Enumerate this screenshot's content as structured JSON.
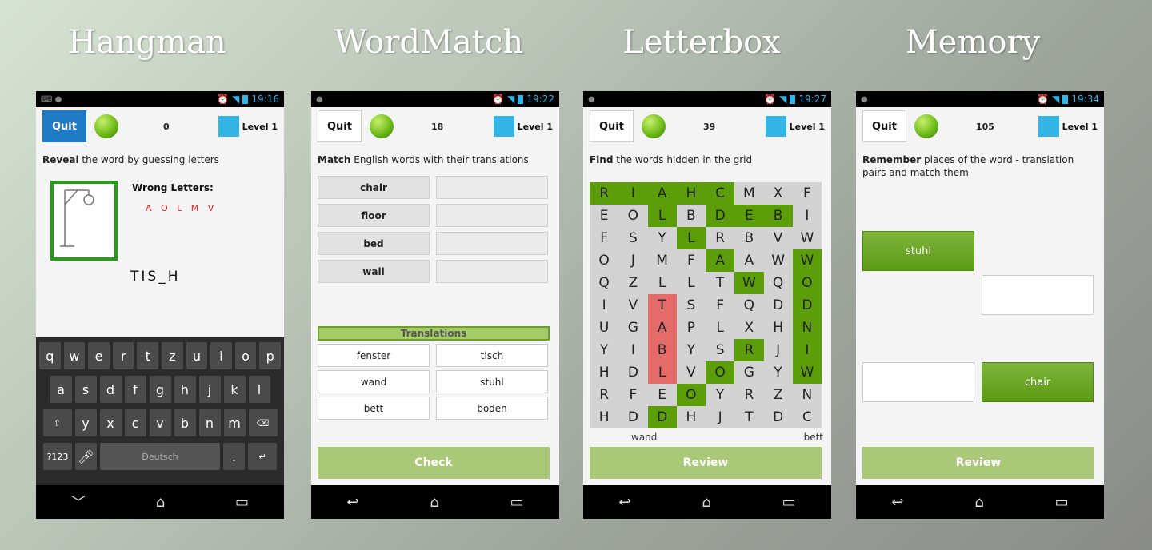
{
  "titles": [
    "Hangman",
    "WordMatch",
    "Letterbox",
    "Memory"
  ],
  "colors": {
    "accent_green": "#5b9e0a",
    "blue": "#33b5e5",
    "quit_blue": "#1e7ac4",
    "wrong_red": "#d22222",
    "button_green": "#a9c978"
  },
  "common": {
    "quit_label": "Quit",
    "level_label": "Level 1"
  },
  "hangman": {
    "time": "19:16",
    "score": "0",
    "instr_bold": "Reveal",
    "instr_rest": " the word by guessing letters",
    "wrong_title": "Wrong Letters:",
    "wrong_letters": "A O L M V",
    "word": "TIS_H",
    "keyboard": {
      "row1": [
        "q",
        "w",
        "e",
        "r",
        "t",
        "z",
        "u",
        "i",
        "o",
        "p"
      ],
      "row2": [
        "a",
        "s",
        "d",
        "f",
        "g",
        "h",
        "j",
        "k",
        "l"
      ],
      "row3": [
        "y",
        "x",
        "c",
        "v",
        "b",
        "n",
        "m"
      ],
      "num_key": "?123",
      "space_label": "Deutsch",
      "period": "."
    }
  },
  "wordmatch": {
    "time": "19:22",
    "score": "18",
    "instr_bold": "Match",
    "instr_rest": " English words with their translations",
    "english": [
      "chair",
      "floor",
      "bed",
      "wall"
    ],
    "translations_label": "Translations",
    "translations": [
      "fenster",
      "tisch",
      "wand",
      "stuhl",
      "bett",
      "boden"
    ],
    "check_label": "Check"
  },
  "letterbox": {
    "time": "19:27",
    "score": "39",
    "instr_bold": "Find",
    "instr_rest": " the words hidden in the grid",
    "grid": [
      "RIAHCMXF",
      "EOLBDEBI",
      "FSYLRBVW",
      "OJMFAAWW",
      "QZLLTWQO",
      "IVTSFQDD",
      "UGAPLXHN",
      "YIBYSRJI",
      "HDLVOGYW",
      "RFEOYRZN",
      "HDDHJTDC"
    ],
    "green_cells": [
      [
        0,
        0
      ],
      [
        0,
        1
      ],
      [
        0,
        2
      ],
      [
        0,
        3
      ],
      [
        0,
        4
      ],
      [
        1,
        2
      ],
      [
        1,
        4
      ],
      [
        1,
        5
      ],
      [
        1,
        6
      ],
      [
        2,
        3
      ],
      [
        3,
        4
      ],
      [
        3,
        7
      ],
      [
        4,
        5
      ],
      [
        4,
        7
      ],
      [
        5,
        7
      ],
      [
        6,
        7
      ],
      [
        7,
        5
      ],
      [
        7,
        7
      ],
      [
        8,
        4
      ],
      [
        8,
        7
      ],
      [
        9,
        3
      ],
      [
        10,
        2
      ]
    ],
    "red_cells": [
      [
        5,
        2
      ],
      [
        6,
        2
      ],
      [
        7,
        2
      ],
      [
        8,
        2
      ]
    ],
    "below_words": [
      "wand",
      "bett"
    ],
    "review_label": "Review"
  },
  "memory": {
    "time": "19:34",
    "score": "105",
    "instr_bold": "Remember",
    "instr_rest": " places of the word - translation pairs and match them",
    "card1": "stuhl",
    "card2": "chair",
    "review_label": "Review"
  }
}
